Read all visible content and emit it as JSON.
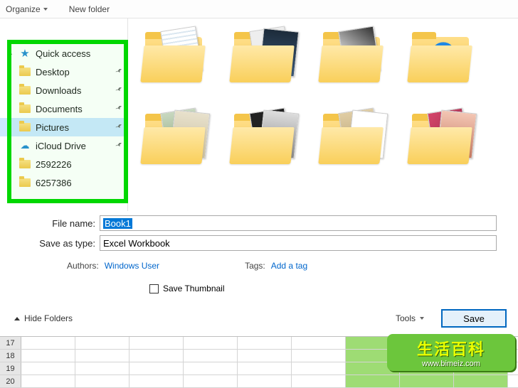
{
  "toolbar": {
    "organize": "Organize",
    "new_folder": "New folder"
  },
  "nav": {
    "root": "Quick access",
    "items": [
      {
        "label": "Desktop",
        "icon": "folder",
        "pinned": true
      },
      {
        "label": "Downloads",
        "icon": "folder",
        "pinned": true
      },
      {
        "label": "Documents",
        "icon": "folder",
        "pinned": true
      },
      {
        "label": "Pictures",
        "icon": "folder",
        "pinned": true,
        "selected": true
      },
      {
        "label": "iCloud Drive",
        "icon": "cloud",
        "pinned": true
      },
      {
        "label": "2592226",
        "icon": "folder",
        "pinned": false
      },
      {
        "label": "6257386",
        "icon": "folder",
        "pinned": false
      }
    ]
  },
  "file_name_label": "File name:",
  "file_name_value": "Book1",
  "save_type_label": "Save as type:",
  "save_type_value": "Excel Workbook",
  "authors_label": "Authors:",
  "authors_value": "Windows User",
  "tags_label": "Tags:",
  "tags_value": "Add a tag",
  "save_thumbnail_label": "Save Thumbnail",
  "hide_folders": "Hide Folders",
  "tools_label": "Tools",
  "save_label": "Save",
  "sheet_rows": [
    "17",
    "18",
    "19",
    "20"
  ],
  "watermark": {
    "title": "生活百科",
    "url": "www.bimeiz.com"
  }
}
